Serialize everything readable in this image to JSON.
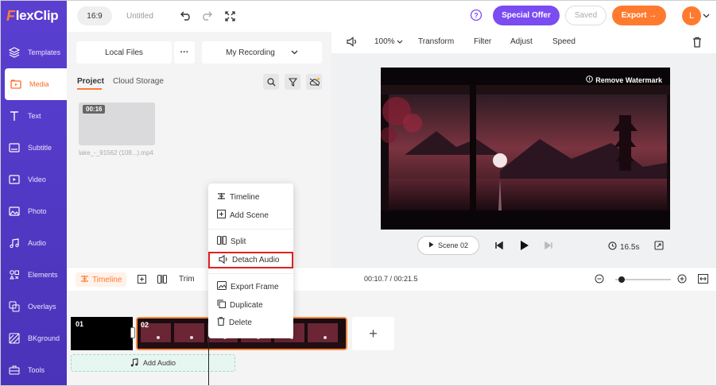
{
  "brand": {
    "logo_f": "F",
    "logo_rest": "lexClip"
  },
  "sidebar": {
    "items": [
      {
        "label": "Templates",
        "icon": "layers-icon"
      },
      {
        "label": "Media",
        "icon": "media-folder-icon",
        "active": true
      },
      {
        "label": "Text",
        "icon": "text-icon"
      },
      {
        "label": "Subtitle",
        "icon": "subtitle-icon"
      },
      {
        "label": "Video",
        "icon": "video-icon"
      },
      {
        "label": "Photo",
        "icon": "photo-icon"
      },
      {
        "label": "Audio",
        "icon": "audio-icon"
      },
      {
        "label": "Elements",
        "icon": "elements-icon"
      },
      {
        "label": "Overlays",
        "icon": "overlays-icon"
      },
      {
        "label": "BKground",
        "icon": "background-icon"
      },
      {
        "label": "Tools",
        "icon": "tools-icon"
      }
    ]
  },
  "topbar": {
    "ratio": "16:9",
    "title": "Untitled",
    "special_offer": "Special Offer",
    "saved": "Saved",
    "export": "Export →",
    "avatar": "L"
  },
  "media": {
    "local_files": "Local Files",
    "more": "···",
    "my_recording": "My Recording",
    "tab_project": "Project",
    "tab_cloud": "Cloud Storage",
    "thumb_duration": "00:16",
    "thumb_name": "lake_-_91562 (108...).mp4"
  },
  "preview_toolbar": {
    "zoom": "100%",
    "transform": "Transform",
    "filter": "Filter",
    "adjust": "Adjust",
    "speed": "Speed"
  },
  "preview": {
    "remove_watermark": "Remove Watermark",
    "scene": "Scene 02",
    "duration": "16.5s"
  },
  "timeline": {
    "label": "Timeline",
    "trim": "Trim",
    "time": "00:10.7 / 00:21.5",
    "zoom_level": 0.05,
    "clip1": "01",
    "clip2": "02",
    "add": "+",
    "add_audio": "Add Audio"
  },
  "context_menu": {
    "items": [
      {
        "label": "Timeline",
        "icon": "timeline-icon"
      },
      {
        "label": "Add Scene",
        "icon": "add-scene-icon"
      },
      {
        "label": "Split",
        "icon": "split-icon"
      },
      {
        "label": "Detach Audio",
        "icon": "detach-audio-icon",
        "highlighted": true
      },
      {
        "label": "Export Frame",
        "icon": "export-frame-icon"
      },
      {
        "label": "Duplicate",
        "icon": "duplicate-icon"
      },
      {
        "label": "Delete",
        "icon": "delete-icon"
      }
    ]
  },
  "colors": {
    "accent": "#ff7a2e",
    "sidebar": "#5a3fd1",
    "special": "#7a4cf2",
    "highlight": "#e02020"
  }
}
